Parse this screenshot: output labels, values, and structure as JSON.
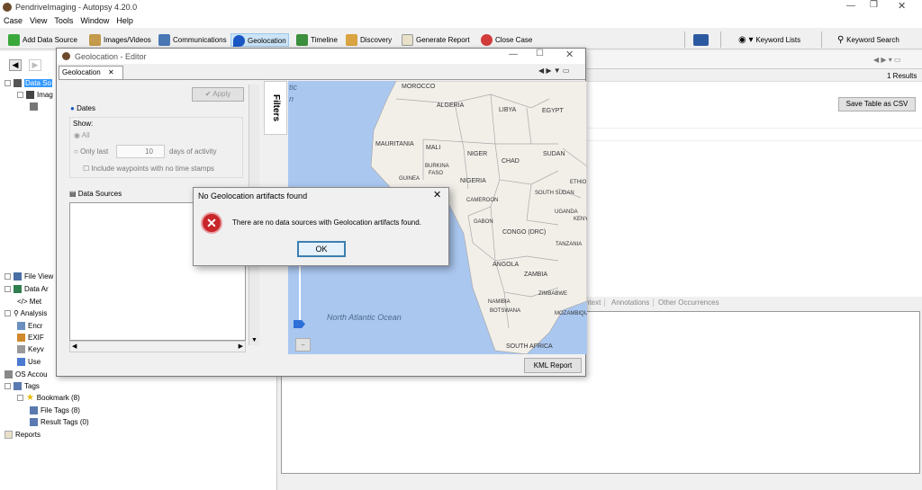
{
  "window": {
    "title": "PendriveImaging - Autopsy 4.20.0"
  },
  "menu": [
    "Case",
    "View",
    "Tools",
    "Window",
    "Help"
  ],
  "toolbar": {
    "add_data_source": "Add Data Source",
    "images_videos": "Images/Videos",
    "communications": "Communications",
    "geolocation": "Geolocation",
    "timeline": "Timeline",
    "discovery": "Discovery",
    "generate_report": "Generate Report",
    "close_case": "Close Case",
    "keyword_lists": "Keyword Lists",
    "keyword_search": "Keyword Search"
  },
  "tree": {
    "data_sources": "Data So",
    "images": "Imag",
    "file_views": "File View",
    "data_artifacts": "Data Ar",
    "metadata": "Met",
    "analysis_results": "Analysis",
    "encryption": "Encr",
    "exif": "EXIF",
    "keyword_hits": "Keyv",
    "user_content": "Use",
    "os_accounts": "OS Accou",
    "tags": "Tags",
    "bookmark": "Bookmark (8)",
    "file_tags": "File Tags (8)",
    "result_tags": "Result Tags (0)",
    "reports": "Reports"
  },
  "results": {
    "count": "1  Results",
    "save_table": "Save Table as CSV",
    "tabs": [
      "ntext",
      "Annotations",
      "Other Occurrences"
    ]
  },
  "geo_dialog": {
    "title": "Geolocation - Editor",
    "tab": "Geolocation",
    "filters_tab": "Filters",
    "apply": "Apply",
    "dates": "Dates",
    "show": "Show:",
    "all": "All",
    "only_last": "Only last",
    "days_value": "10",
    "days_suffix": "days of activity",
    "include_waypoints": "Include waypoints with no time stamps",
    "data_sources": "Data Sources",
    "kml_report": "KML Report"
  },
  "map": {
    "labels": [
      "tic",
      "n",
      "MOROCCO",
      "ALGERIA",
      "LIBYA",
      "EGYPT",
      "MAURITANIA",
      "MALI",
      "NIGER",
      "CHAD",
      "SUDAN",
      "BURKINA",
      "FASO",
      "GUINEA",
      "NIGERIA",
      "ETHIO",
      "SOUTH SUDAN",
      "CAMEROON",
      "UGANDA",
      "GABON",
      "KENY",
      "CONGO (DRC)",
      "TANZANIA",
      "ANGOLA",
      "ZAMBIA",
      "NAMIBIA",
      "ZIMBABWE",
      "BOTSWANA",
      "MOZAMBIQU",
      "North Atlantic Ocean",
      "SOUTH AFRICA"
    ]
  },
  "alert": {
    "title": "No Geolocation artifacts found",
    "message": "There are no data sources with Geolocation artifacts found.",
    "ok": "OK"
  }
}
